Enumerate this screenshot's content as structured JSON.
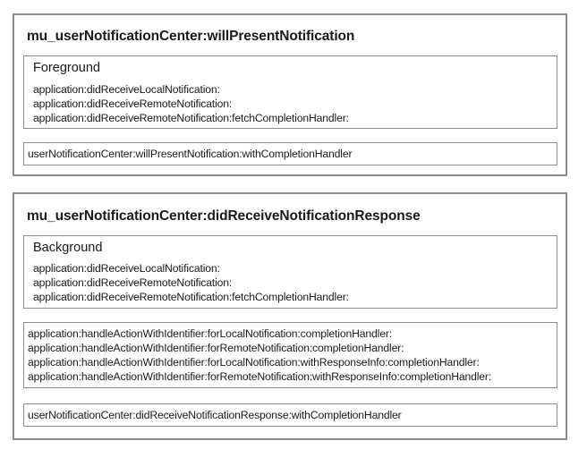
{
  "panels": [
    {
      "title": "mu_userNotificationCenter:willPresentNotification",
      "state_box": {
        "heading": "Foreground",
        "lines": [
          "application:didReceiveLocalNotification:",
          "application:didReceiveRemoteNotification:",
          "application:didReceiveRemoteNotification:fetchCompletionHandler:"
        ]
      },
      "handler_box": {
        "lines": [
          "userNotificationCenter:willPresentNotification:withCompletionHandler"
        ]
      }
    },
    {
      "title": "mu_userNotificationCenter:didReceiveNotificationResponse",
      "state_box": {
        "heading": "Background",
        "lines": [
          "application:didReceiveLocalNotification:",
          "application:didReceiveRemoteNotification:",
          "application:didReceiveRemoteNotification:fetchCompletionHandler:"
        ]
      },
      "action_box": {
        "lines": [
          "application:handleActionWithIdentifier:forLocalNotification:completionHandler:",
          "application:handleActionWithIdentifier:forRemoteNotification:completionHandler:",
          "application:handleActionWithIdentifier:forLocalNotification:withResponseInfo:completionHandler:",
          "application:handleActionWithIdentifier:forRemoteNotification:withResponseInfo:completionHandler:"
        ]
      },
      "handler_box": {
        "lines": [
          "userNotificationCenter:didReceiveNotificationResponse:withCompletionHandler"
        ]
      }
    }
  ]
}
